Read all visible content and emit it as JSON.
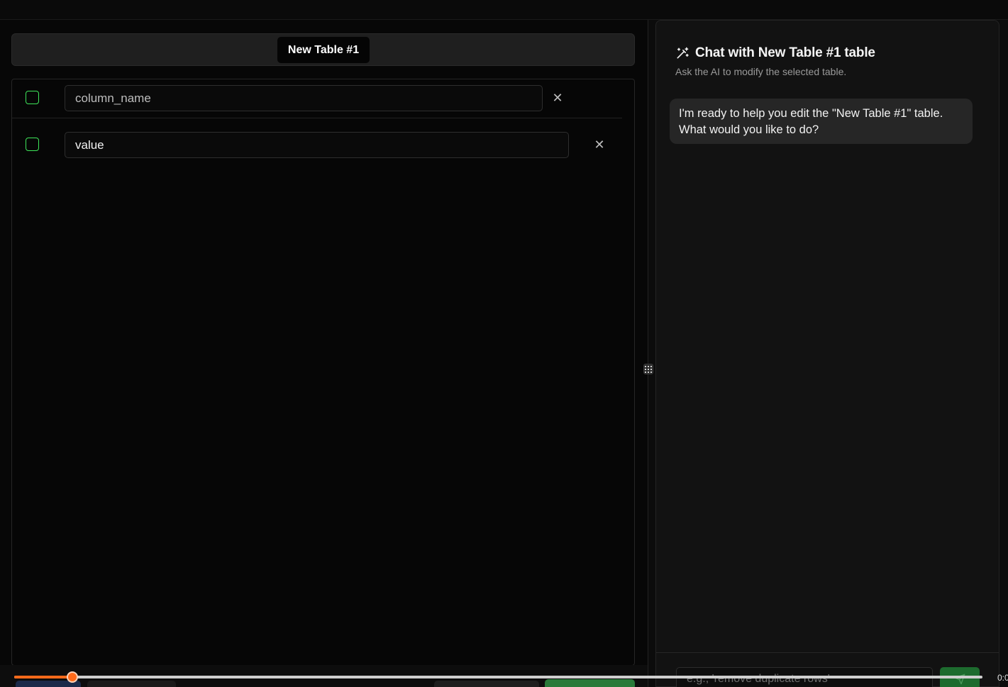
{
  "tabs": [
    {
      "label": "New Table #1",
      "active": true
    }
  ],
  "grid": {
    "rows": [
      {
        "placeholder": "column_name",
        "value": "",
        "checked": false
      },
      {
        "placeholder": "",
        "value": "value",
        "checked": false
      }
    ],
    "delete_glyph": "✕"
  },
  "chat": {
    "title": "Chat with New Table #1 table",
    "subtitle": "Ask the AI to modify the selected table.",
    "messages": [
      {
        "role": "assistant",
        "text": "I'm ready to help you edit the \"New Table #1\" table. What would you like to do?"
      }
    ],
    "input_placeholder": "e.g., 'remove duplicate rows'"
  },
  "player": {
    "progress": 0.06,
    "time": "0:0"
  },
  "colors": {
    "accent_green": "#3ee65a",
    "send_green": "#1d6b2e",
    "seek_orange": "#ff6a1a"
  },
  "icons": {
    "chat_title": "magic-wand-icon",
    "send": "send-icon",
    "resize": "grip-icon",
    "delete": "close-icon"
  }
}
